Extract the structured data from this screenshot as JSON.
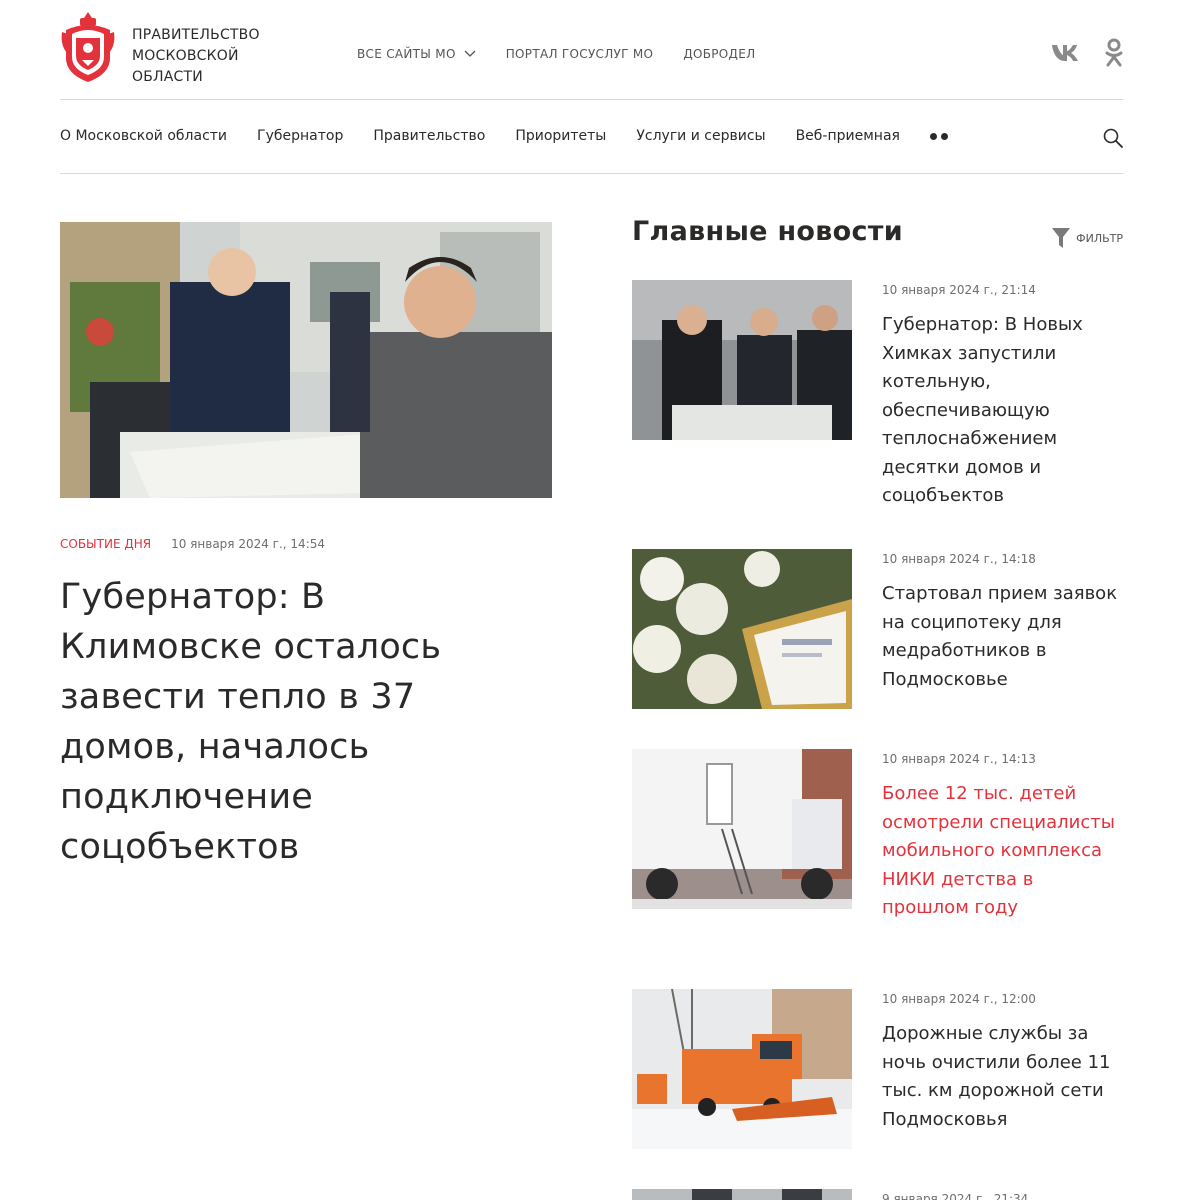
{
  "brand": {
    "line1": "ПРАВИТЕЛЬСТВО",
    "line2": "МОСКОВСКОЙ",
    "line3": "ОБЛАСТИ",
    "logo_icon": "coat-of-arms-icon",
    "accent_color": "#e3323c"
  },
  "top_links": [
    {
      "label": "ВСЕ САЙТЫ МО",
      "icon": "chevron-down-icon"
    },
    {
      "label": "ПОРТАЛ ГОСУСЛУГ МО"
    },
    {
      "label": "ДОБРОДЕЛ"
    }
  ],
  "social": [
    {
      "icon": "vk-icon"
    },
    {
      "icon": "odnoklassniki-icon"
    }
  ],
  "nav": {
    "items": [
      "О Московской области",
      "Губернатор",
      "Правительство",
      "Приоритеты",
      "Услуги и сервисы",
      "Веб-приемная"
    ],
    "more_icon": "more-dots-icon",
    "search_icon": "search-icon"
  },
  "featured": {
    "tag": "СОБЫТИЕ ДНЯ",
    "date": "10 января 2024 г., 14:54",
    "title": "Губернатор: В Климовске осталось завести тепло в 37 домов, началось подключение соцобъектов"
  },
  "news": {
    "heading": "Главные новости",
    "filter_label": "ФИЛЬТР",
    "filter_icon": "funnel-icon",
    "items": [
      {
        "date": "10 января 2024 г., 21:14",
        "title": "Губернатор: В Новых Химках запустили котельную, обеспечивающую теплоснабжением десятки домов и соцобъектов",
        "highlighted": false
      },
      {
        "date": "10 января 2024 г., 14:18",
        "title": "Стартовал прием заявок на соципотеку для медработников в Подмосковье",
        "highlighted": false
      },
      {
        "date": "10 января 2024 г., 14:13",
        "title": "Более 12 тыс. детей осмотрели специалисты мобильного комплекса НИКИ детства в прошлом году",
        "highlighted": true
      },
      {
        "date": "10 января 2024 г., 12:00",
        "title": "Дорожные службы за ночь очистили более 11 тыс. км дорожной сети Подмосковья",
        "highlighted": false
      },
      {
        "date": "9 января 2024 г., 21:34",
        "title": "",
        "highlighted": false
      }
    ]
  }
}
